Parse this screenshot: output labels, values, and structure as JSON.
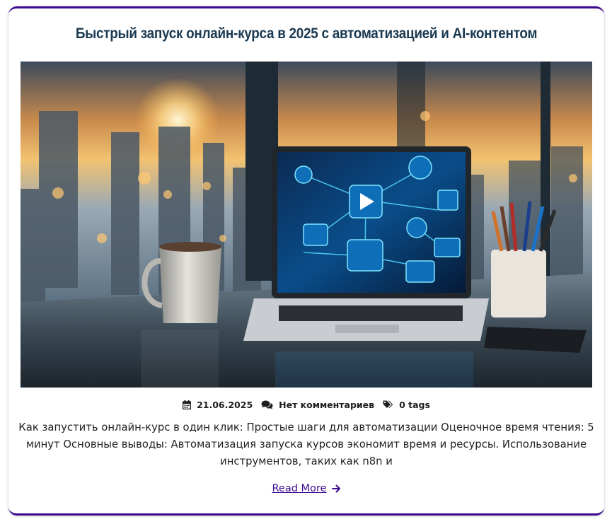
{
  "post": {
    "title": "Быстрый запуск онлайн-курса в 2025 с автоматизацией и AI-контентом",
    "image_alt": "Laptop on a desk by a window showing an automation workflow diagram, with a coffee mug and a pencil cup",
    "meta": {
      "date": "21.06.2025",
      "comments": "Нет комментариев",
      "tags": "0 tags"
    },
    "excerpt": "Как запустить онлайн-курс в один клик: Простые шаги для автоматизации Оценочное время чтения: 5 минут Основные выводы: Автоматизация запуска курсов экономит время и ресурсы. Использование инструментов, таких как n8n и",
    "read_more_label": "Read More"
  },
  "icons": {
    "date": "calendar-icon",
    "comments": "comments-icon",
    "tags": "tags-icon",
    "read_more": "arrow-right-icon"
  },
  "colors": {
    "accent": "#3b0a8f",
    "title": "#1a3a52"
  }
}
